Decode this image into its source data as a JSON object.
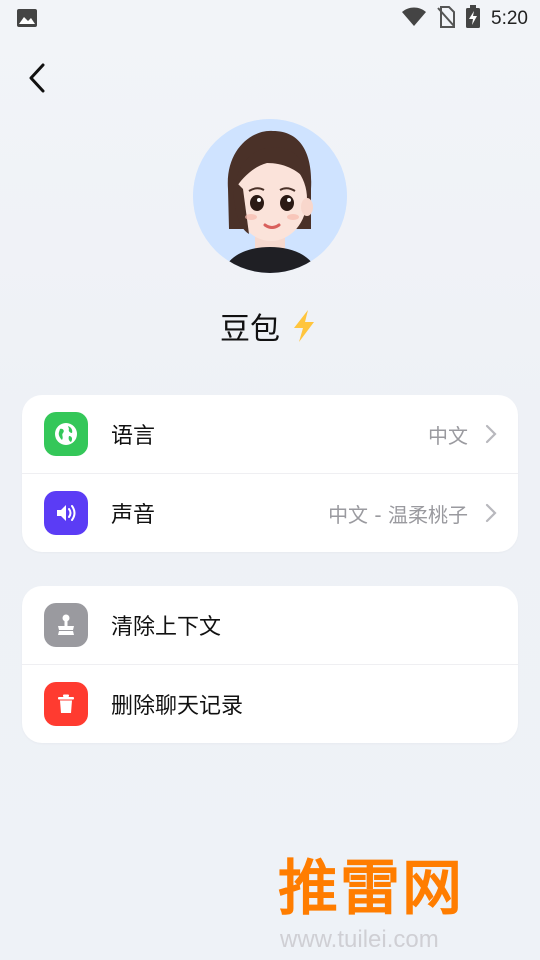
{
  "status_bar": {
    "time": "5:20"
  },
  "profile": {
    "name": "豆包"
  },
  "settings_group_1": [
    {
      "label": "语言",
      "value": "中文",
      "icon": "globe-icon",
      "color": "#34c759"
    },
    {
      "label": "声音",
      "value": "中文 - 温柔桃子",
      "icon": "speaker-icon",
      "color": "#5b3cf5"
    }
  ],
  "settings_group_2": [
    {
      "label": "清除上下文",
      "icon": "broom-icon",
      "color": "#9a9a9f"
    },
    {
      "label": "删除聊天记录",
      "icon": "trash-icon",
      "color": "#ff3b30"
    }
  ],
  "watermark": {
    "brand": "推雷网",
    "url": "www.tuilei.com"
  }
}
